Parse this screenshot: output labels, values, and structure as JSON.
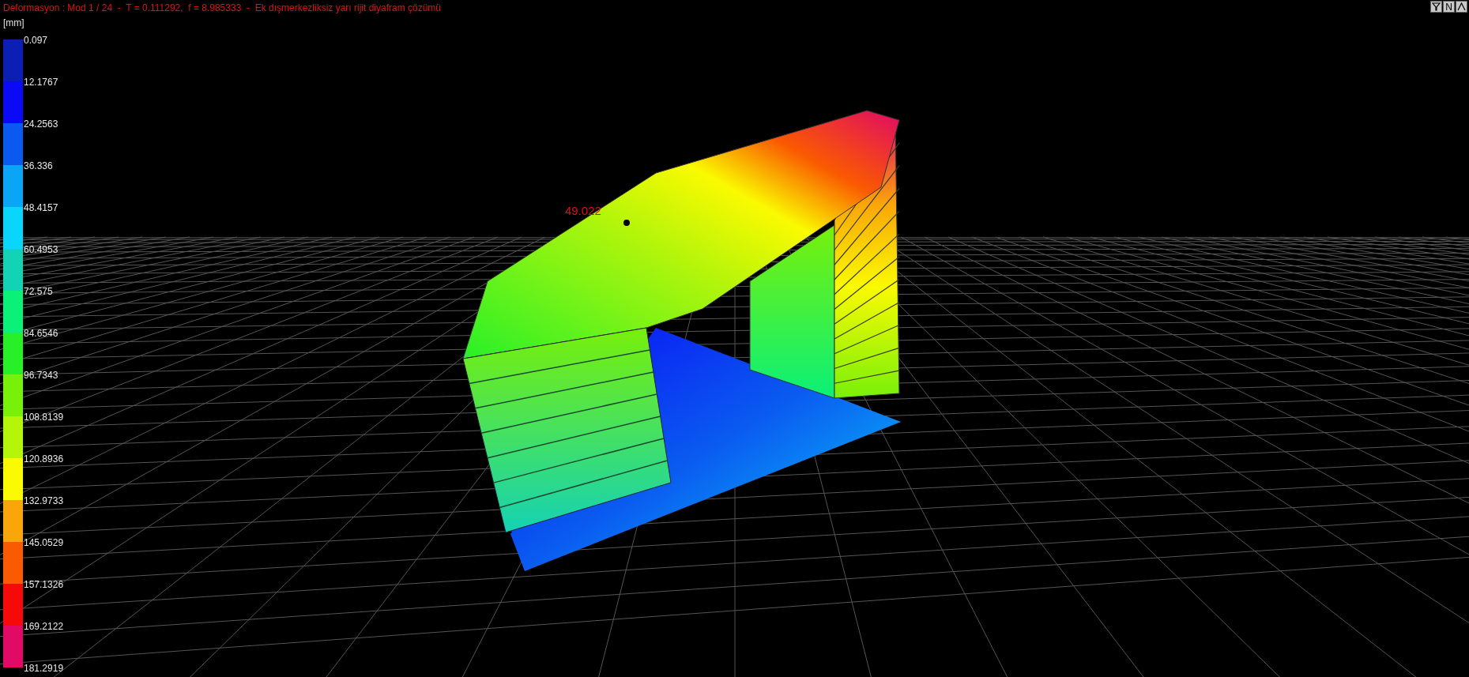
{
  "title": "Deformasyon : Mod 1 / 24  -  T = 0.111292,  f = 8.985333  -  Ek dışmerkezliksiz yarı rijit diyafram çözümü",
  "toolbar": [
    {
      "kind": "filter"
    },
    {
      "kind": "text",
      "label": "N"
    },
    {
      "kind": "caret"
    }
  ],
  "legend": {
    "unit": "[mm]",
    "bands": [
      {
        "color": "#0c1fb5"
      },
      {
        "color": "#0a0af5"
      },
      {
        "color": "#0a5af0"
      },
      {
        "color": "#0aa5f5"
      },
      {
        "color": "#0ad5fa"
      },
      {
        "color": "#14d2b4"
      },
      {
        "color": "#0af078"
      },
      {
        "color": "#28f028"
      },
      {
        "color": "#78f00a"
      },
      {
        "color": "#b4f50a"
      },
      {
        "color": "#fafa00"
      },
      {
        "color": "#faa50a"
      },
      {
        "color": "#fa5a00"
      },
      {
        "color": "#f50a0a"
      },
      {
        "color": "#e10a64"
      }
    ],
    "ticks": [
      "0.097",
      "12.1767",
      "24.2563",
      "36.336",
      "48.4157",
      "60.4953",
      "72.575",
      "84.6546",
      "96.7343",
      "108.8139",
      "120.8936",
      "132.9733",
      "145.0529",
      "157.1326",
      "169.2122",
      "181.2919"
    ]
  },
  "marker_label": "49.022"
}
